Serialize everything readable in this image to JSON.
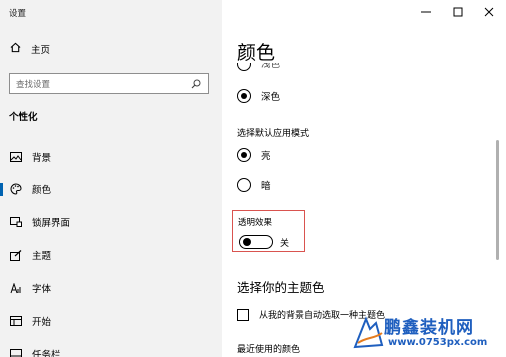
{
  "window": {
    "title": "设置"
  },
  "sidebar": {
    "home_label": "主页",
    "search_placeholder": "查找设置",
    "section_title": "个性化",
    "items": [
      {
        "label": "背景",
        "icon": "image-icon"
      },
      {
        "label": "颜色",
        "icon": "palette-icon",
        "active": true
      },
      {
        "label": "锁屏界面",
        "icon": "lock-screen-icon"
      },
      {
        "label": "主题",
        "icon": "theme-icon"
      },
      {
        "label": "字体",
        "icon": "font-icon"
      },
      {
        "label": "开始",
        "icon": "start-icon"
      },
      {
        "label": "任务栏",
        "icon": "taskbar-icon"
      }
    ]
  },
  "main": {
    "heading": "颜色",
    "windows_mode": {
      "selected": "深色",
      "options": [
        "浅色",
        "深色"
      ]
    },
    "app_mode": {
      "label": "选择默认应用模式",
      "options": [
        "亮",
        "暗"
      ],
      "selected": "亮"
    },
    "transparency": {
      "label": "透明效果",
      "state": "关"
    },
    "accent": {
      "heading": "选择你的主题色",
      "auto_pick_label": "从我的背景自动选取一种主题色",
      "auto_pick_checked": false,
      "recent_label": "最近使用的颜色"
    }
  },
  "watermark": {
    "brand": "鹏鑫装机网",
    "url": "www.0753px.com"
  },
  "colors": {
    "accent": "#0063b1",
    "highlight": "#d9534f"
  }
}
